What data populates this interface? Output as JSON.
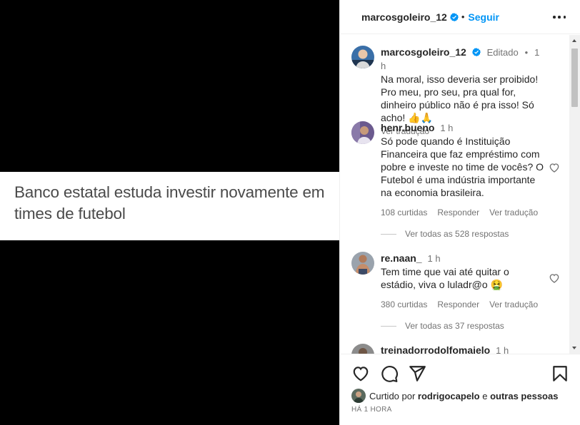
{
  "media": {
    "headline": "Banco estatal estuda investir novamente em times de futebol"
  },
  "header": {
    "username": "marcosgoleiro_12",
    "dot": "•",
    "follow_label": "Seguir"
  },
  "caption": {
    "username": "marcosgoleiro_12",
    "edited": "Editado",
    "dot": "•",
    "time": "1 h",
    "text": "Na moral, isso deveria ser proibido! Pro meu, pro seu, pra qual for, dinheiro público não é pra isso! Só acho! 👍🙏",
    "see_translation": "Ver tradução"
  },
  "comments": [
    {
      "username": "henr.bueno",
      "time": "1 h",
      "text": "Só pode quando é Instituição Financeira que faz empréstimo com pobre e investe no time de vocês? O Futebol é uma indústria importante na economia brasileira.",
      "likes": "108 curtidas",
      "reply": "Responder",
      "translate": "Ver tradução",
      "view_replies": "Ver todas as 528 respostas"
    },
    {
      "username": "re.naan_",
      "time": "1 h",
      "text": "Tem time que vai até quitar o estádio, viva o luladr@o 🤮",
      "likes": "380 curtidas",
      "reply": "Responder",
      "translate": "Ver tradução",
      "view_replies": "Ver todas as 37 respostas"
    },
    {
      "username": "treinadorrodolfomaielo",
      "time": "1 h"
    }
  ],
  "footer": {
    "liked_prefix": "Curtido por ",
    "liked_user": "rodrigocapelo",
    "liked_suffix": " e ",
    "liked_others": "outras pessoas",
    "timestamp": "HÁ 1 HORA"
  },
  "icons": {
    "verified": "verified-badge-icon",
    "like": "heart-icon",
    "comment": "comment-bubble-icon",
    "share": "paper-plane-icon",
    "save": "bookmark-icon",
    "more": "more-horizontal-icon"
  },
  "colors": {
    "link": "#0095f6",
    "text": "#262626",
    "muted": "#737373",
    "verified": "#0095f6"
  }
}
